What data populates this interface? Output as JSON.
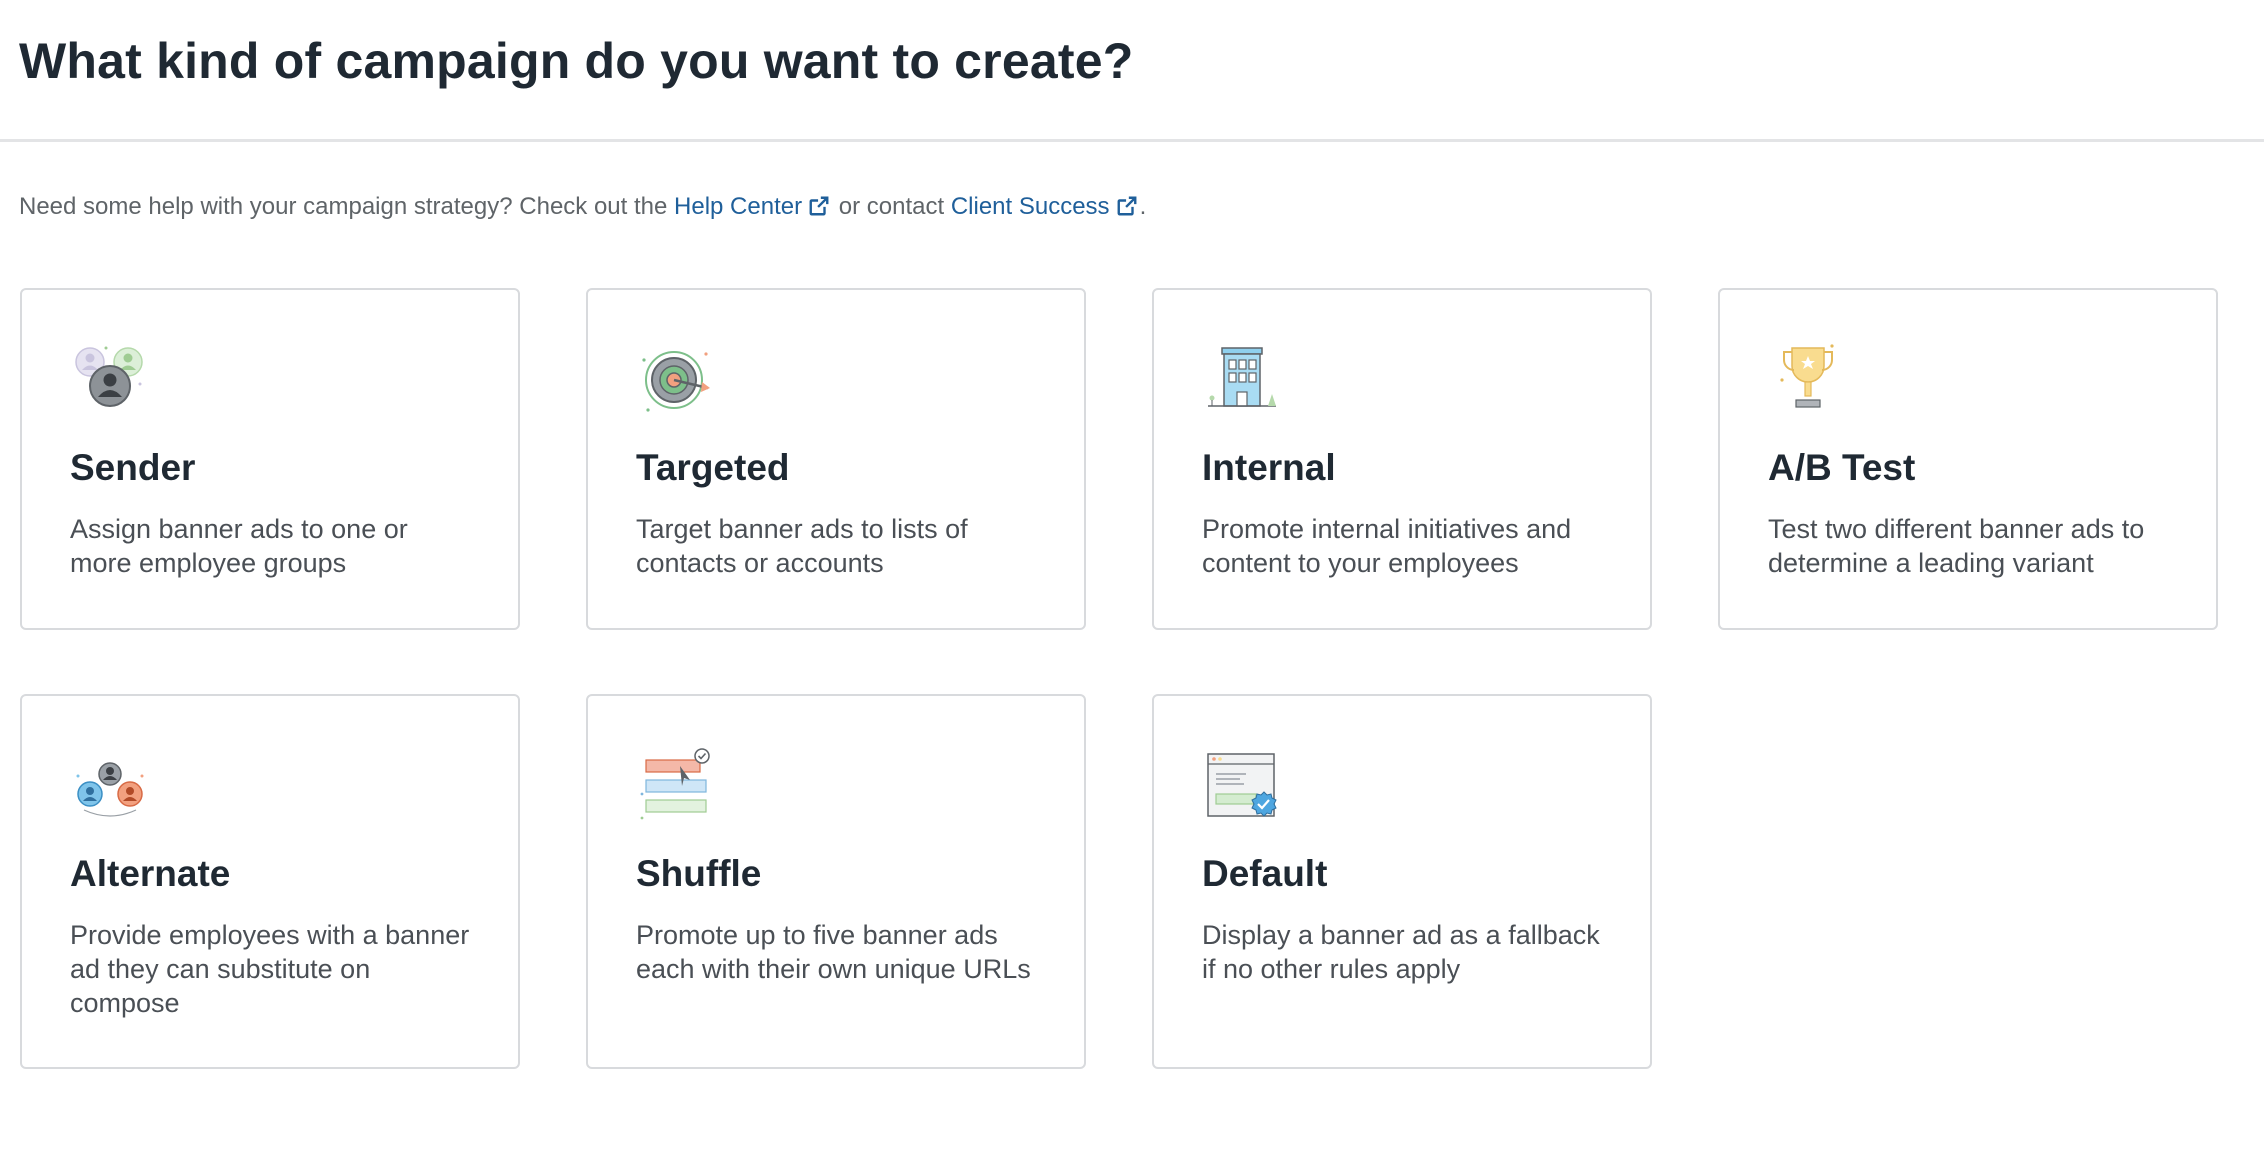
{
  "header": {
    "title": "What kind of campaign do you want to create?"
  },
  "help": {
    "prefix": "Need some help with your campaign strategy? Check out the ",
    "help_center_link": "Help Center",
    "middle": " or contact ",
    "client_success_link": "Client Success",
    "suffix": "."
  },
  "cards": [
    {
      "icon": "people-group-icon",
      "title": "Sender",
      "description": "Assign banner ads to one or more employee groups"
    },
    {
      "icon": "target-icon",
      "title": "Targeted",
      "description": "Target banner ads to lists of contacts or accounts"
    },
    {
      "icon": "building-icon",
      "title": "Internal",
      "description": "Promote internal initiatives and content to your employees"
    },
    {
      "icon": "trophy-icon",
      "title": "A/B Test",
      "description": "Test two different banner ads to determine a leading variant"
    },
    {
      "icon": "alternate-people-icon",
      "title": "Alternate",
      "description": "Provide employees with a banner ad they can substitute on compose"
    },
    {
      "icon": "shuffle-banners-icon",
      "title": "Shuffle",
      "description": "Promote up to five banner ads each with their own unique URLs"
    },
    {
      "icon": "default-browser-icon",
      "title": "Default",
      "description": "Display a banner ad as a fallback if no other rules apply"
    }
  ]
}
